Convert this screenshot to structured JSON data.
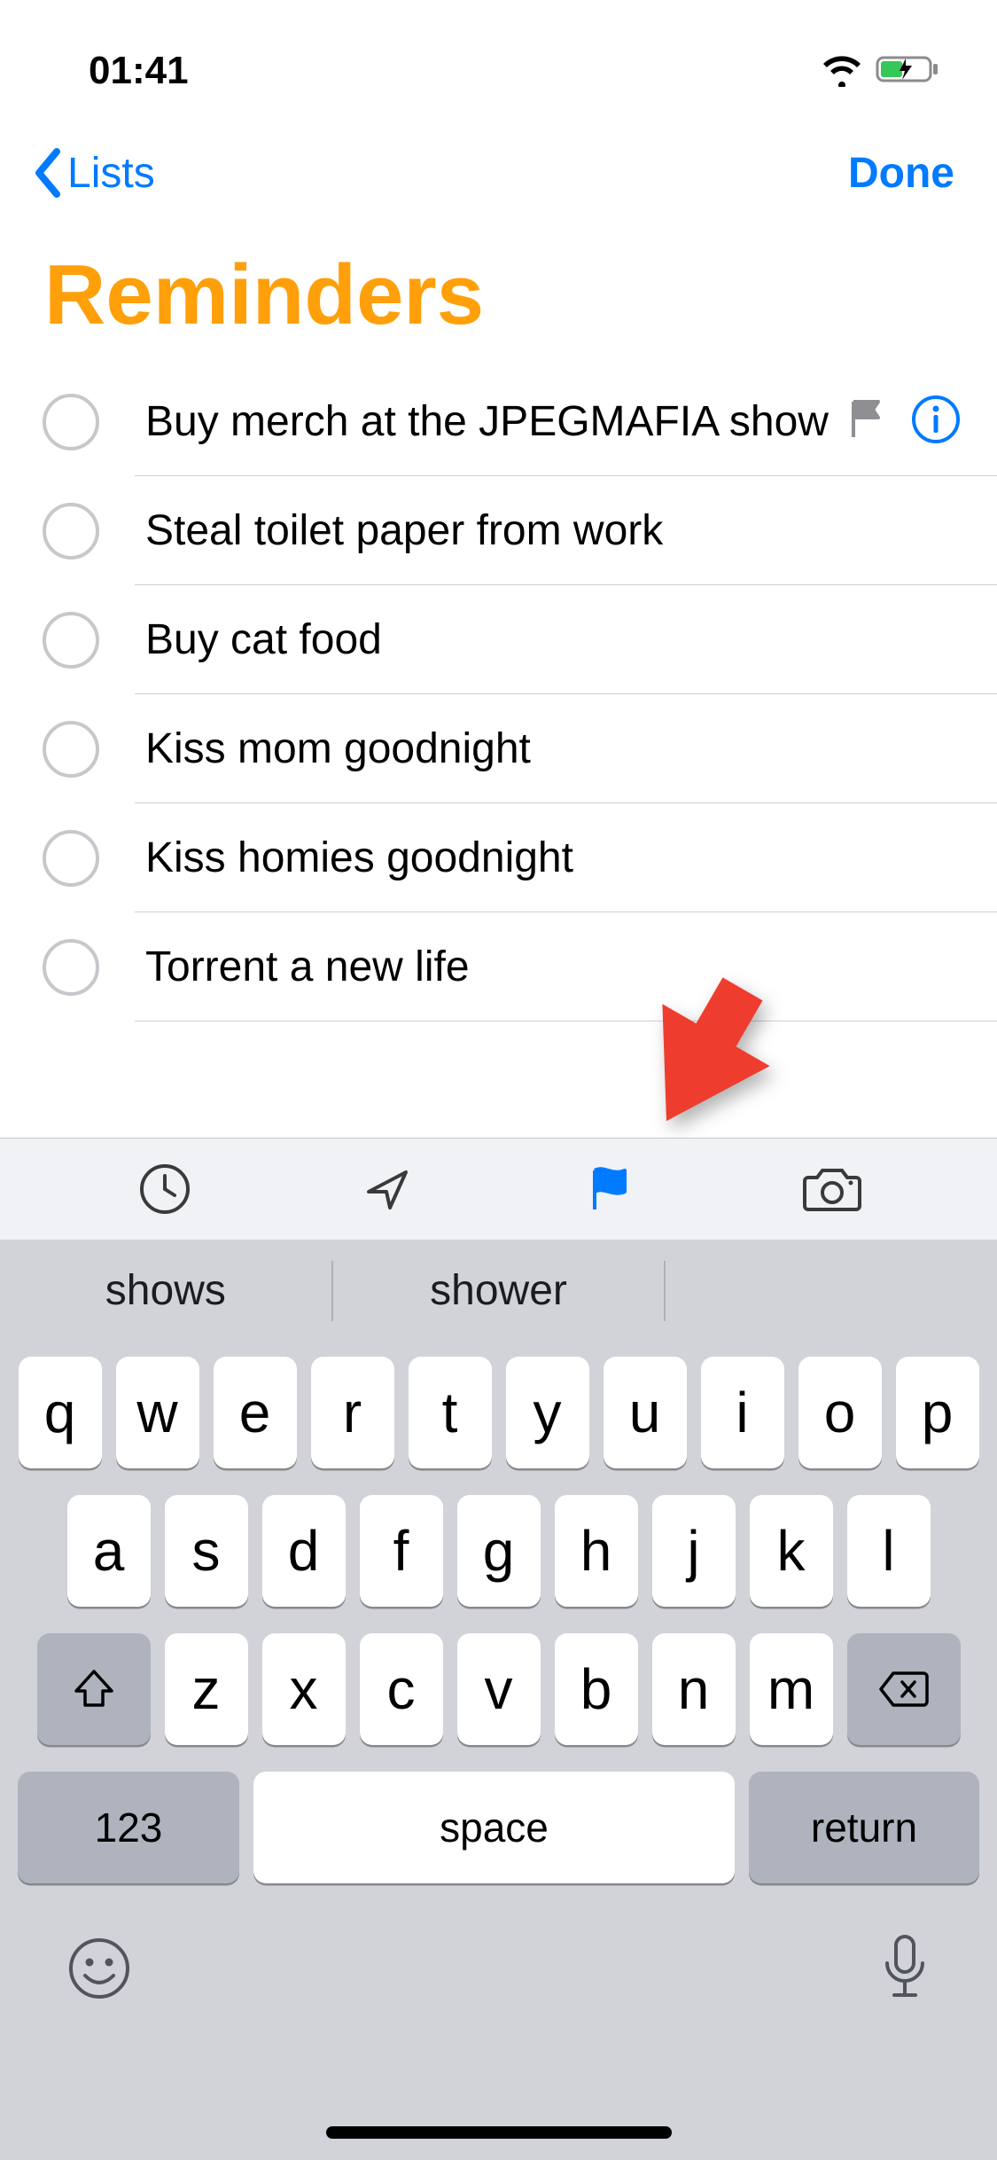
{
  "status": {
    "time": "01:41"
  },
  "nav": {
    "back_label": "Lists",
    "done_label": "Done"
  },
  "page": {
    "title": "Reminders"
  },
  "reminders": [
    {
      "text": "Buy merch at the JPEGMAFIA show",
      "flagged": true,
      "editing": true
    },
    {
      "text": "Steal toilet paper from work"
    },
    {
      "text": "Buy cat food"
    },
    {
      "text": "Kiss mom goodnight"
    },
    {
      "text": "Kiss homies goodnight"
    },
    {
      "text": "Torrent a new life"
    }
  ],
  "keyboard": {
    "suggestions": [
      "shows",
      "shower",
      ""
    ],
    "rows": [
      [
        "q",
        "w",
        "e",
        "r",
        "t",
        "y",
        "u",
        "i",
        "o",
        "p"
      ],
      [
        "a",
        "s",
        "d",
        "f",
        "g",
        "h",
        "j",
        "k",
        "l"
      ],
      [
        "z",
        "x",
        "c",
        "v",
        "b",
        "n",
        "m"
      ]
    ],
    "numbers_label": "123",
    "space_label": "space",
    "return_label": "return"
  },
  "toolbar": {
    "icons": [
      "clock-icon",
      "location-icon",
      "flag-icon",
      "camera-icon"
    ],
    "active_index": 2
  },
  "colors": {
    "accent_blue": "#007aff",
    "accent_orange": "#ff9f0a",
    "annotation_red": "#ee3d2f"
  }
}
